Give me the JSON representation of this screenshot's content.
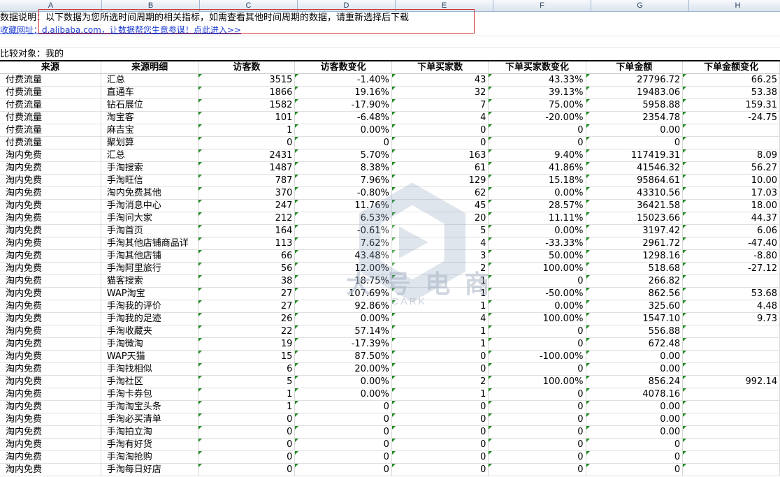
{
  "columns": [
    "A",
    "B",
    "C",
    "D",
    "E",
    "F",
    "G",
    "H"
  ],
  "info": {
    "description": "数据说明：以下数据为您所选时间周期的相关指标，如需查看其他时间周期的数据，请重新选择后下载",
    "link": "收藏网址：d.alibaba.com，让数据帮您生意参谋！点此进入>>",
    "compare": "比较对象：我的"
  },
  "watermark": {
    "main": "大 号 电 商",
    "sub": "CARK"
  },
  "table": {
    "headers": [
      "来源",
      "来源明细",
      "访客数",
      "访客数变化",
      "下单买家数",
      "下单买家数变化",
      "下单金额",
      "下单金额变化"
    ],
    "rows": [
      [
        "付费流量",
        "汇总",
        "3515",
        "-1.40%",
        "43",
        "43.33%",
        "27796.72",
        "66.25"
      ],
      [
        "付费流量",
        "直通车",
        "1866",
        "19.16%",
        "32",
        "39.13%",
        "19483.06",
        "53.38"
      ],
      [
        "付费流量",
        "钻石展位",
        "1582",
        "-17.90%",
        "7",
        "75.00%",
        "5958.88",
        "159.31"
      ],
      [
        "付费流量",
        "淘宝客",
        "101",
        "-6.48%",
        "4",
        "-20.00%",
        "2354.78",
        "-24.75"
      ],
      [
        "付费流量",
        "麻吉宝",
        "1",
        "0.00%",
        "0",
        "0",
        "0.00",
        ""
      ],
      [
        "付费流量",
        "聚划算",
        "0",
        "0",
        "0",
        "0",
        "0",
        ""
      ],
      [
        "淘内免费",
        "汇总",
        "2431",
        "5.70%",
        "163",
        "9.40%",
        "117419.31",
        "8.09"
      ],
      [
        "淘内免费",
        "手淘搜索",
        "1487",
        "8.38%",
        "61",
        "41.86%",
        "41546.32",
        "56.27"
      ],
      [
        "淘内免费",
        "手淘旺信",
        "787",
        "7.96%",
        "129",
        "15.18%",
        "95864.61",
        "10.00"
      ],
      [
        "淘内免费",
        "淘内免费其他",
        "370",
        "-0.80%",
        "62",
        "0.00%",
        "43310.56",
        "17.03"
      ],
      [
        "淘内免费",
        "手淘消息中心",
        "247",
        "11.76%",
        "45",
        "28.57%",
        "36421.58",
        "18.00"
      ],
      [
        "淘内免费",
        "手淘问大家",
        "212",
        "6.53%",
        "20",
        "11.11%",
        "15023.66",
        "44.37"
      ],
      [
        "淘内免费",
        "手淘首页",
        "164",
        "-0.61%",
        "5",
        "0.00%",
        "3197.42",
        "6.06"
      ],
      [
        "淘内免费",
        "手淘其他店铺商品详",
        "113",
        "7.62%",
        "4",
        "-33.33%",
        "2961.72",
        "-47.40"
      ],
      [
        "淘内免费",
        "手淘其他店铺",
        "66",
        "43.48%",
        "3",
        "50.00%",
        "1298.16",
        "-8.80"
      ],
      [
        "淘内免费",
        "手淘阿里旅行",
        "56",
        "12.00%",
        "2",
        "100.00%",
        "518.68",
        "-27.12"
      ],
      [
        "淘内免费",
        "猫客搜索",
        "38",
        "18.75%",
        "1",
        "0",
        "266.82",
        ""
      ],
      [
        "淘内免费",
        "WAP淘宝",
        "27",
        "107.69%",
        "1",
        "-50.00%",
        "862.56",
        "53.68"
      ],
      [
        "淘内免费",
        "手淘我的评价",
        "27",
        "92.86%",
        "1",
        "0.00%",
        "325.60",
        "4.48"
      ],
      [
        "淘内免费",
        "手淘我的足迹",
        "26",
        "0.00%",
        "4",
        "100.00%",
        "1547.10",
        "9.73"
      ],
      [
        "淘内免费",
        "手淘收藏夹",
        "22",
        "57.14%",
        "1",
        "0",
        "556.88",
        ""
      ],
      [
        "淘内免费",
        "手淘微淘",
        "19",
        "-17.39%",
        "1",
        "0",
        "672.48",
        ""
      ],
      [
        "淘内免费",
        "WAP天猫",
        "15",
        "87.50%",
        "0",
        "-100.00%",
        "0.00",
        ""
      ],
      [
        "淘内免费",
        "手淘找相似",
        "6",
        "20.00%",
        "0",
        "0",
        "0.00",
        ""
      ],
      [
        "淘内免费",
        "手淘社区",
        "5",
        "0.00%",
        "2",
        "100.00%",
        "856.24",
        "992.14"
      ],
      [
        "淘内免费",
        "手淘卡券包",
        "1",
        "0.00%",
        "1",
        "0",
        "4078.16",
        ""
      ],
      [
        "淘内免费",
        "手淘淘宝头条",
        "1",
        "0",
        "0",
        "0",
        "0.00",
        ""
      ],
      [
        "淘内免费",
        "手淘必买清单",
        "0",
        "0",
        "0",
        "0",
        "0.00",
        ""
      ],
      [
        "淘内免费",
        "手淘拍立淘",
        "0",
        "0",
        "0",
        "0",
        "0.00",
        ""
      ],
      [
        "淘内免费",
        "手淘有好货",
        "0",
        "0",
        "0",
        "0",
        "0",
        ""
      ],
      [
        "淘内免费",
        "手淘淘抢购",
        "0",
        "0",
        "0",
        "0",
        "0",
        ""
      ],
      [
        "淘内免费",
        "手淘每日好店",
        "0",
        "0",
        "0",
        "0",
        "0",
        ""
      ]
    ]
  }
}
